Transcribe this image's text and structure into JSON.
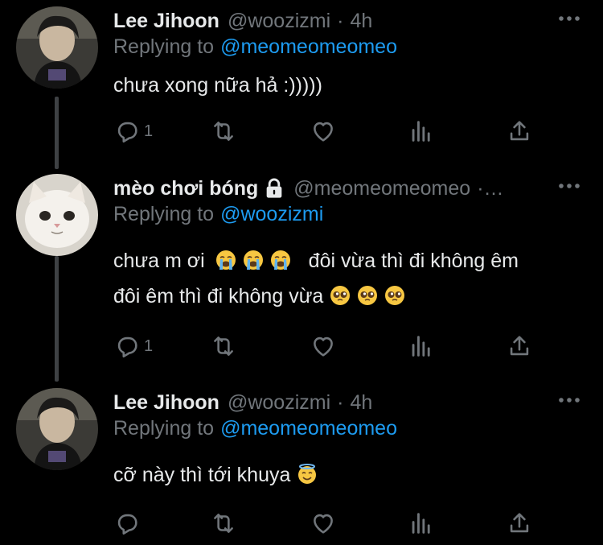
{
  "tweets": [
    {
      "display_name": "Lee Jihoon",
      "handle": "@woozizmi",
      "time": "4h",
      "reply_prefix": "Replying to",
      "reply_handle": "@meomeomeomeo",
      "text_lines": [
        "chưa xong nữa hả :)))))"
      ],
      "reply_count": "1",
      "avatar": "person-avatar"
    },
    {
      "display_name": "mèo chơi bóng",
      "handle": "@meomeomeomeo",
      "time_truncated": "·…",
      "reply_prefix": "Replying to",
      "reply_handle": "@woozizmi",
      "text_line1_a": "chưa m ơi",
      "text_line1_b": "đôi vừa thì đi không êm",
      "text_line2": "đôi êm thì đi không vừa",
      "reply_count": "1",
      "avatar": "cat-avatar",
      "protected": true
    },
    {
      "display_name": "Lee Jihoon",
      "handle": "@woozizmi",
      "time": "4h",
      "reply_prefix": "Replying to",
      "reply_handle": "@meomeomeomeo",
      "text_lines": [
        "cỡ này thì tới khuya"
      ],
      "reply_count": "",
      "avatar": "person-avatar"
    }
  ],
  "colors": {
    "background": "#000000",
    "text": "#e7e9ea",
    "secondary": "#71767b",
    "link": "#1d9bf0"
  },
  "icons": [
    "reply-icon",
    "retweet-icon",
    "like-icon",
    "views-icon",
    "share-icon",
    "more-icon",
    "lock-icon",
    "loudly-crying-emoji",
    "pleading-emoji",
    "halo-emoji"
  ]
}
